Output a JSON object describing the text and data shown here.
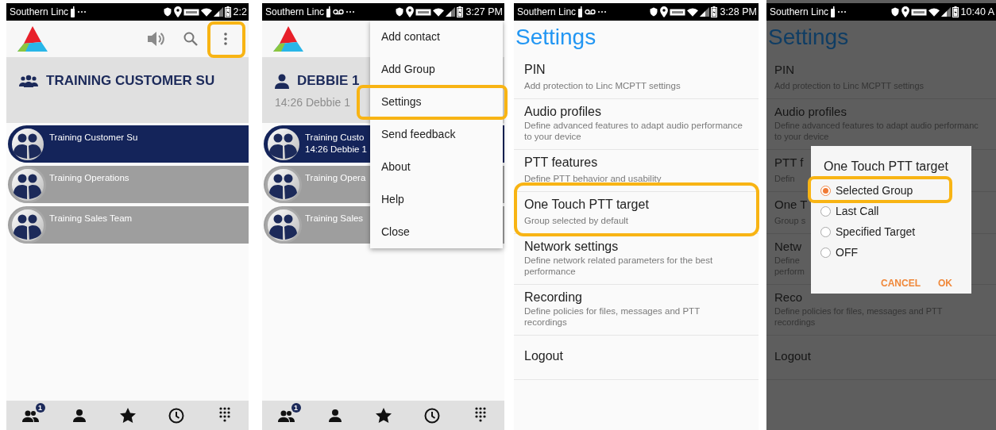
{
  "phones": [
    {
      "kind": "groups",
      "status_bar": {
        "carrier": "Southern Linc",
        "voicemail": false,
        "time": "2:2"
      },
      "actions": [
        {
          "kind": "speaker",
          "highlighted": false
        },
        {
          "kind": "search",
          "highlighted": false
        },
        {
          "kind": "more",
          "highlighted": true
        }
      ],
      "header": {
        "kind": "group",
        "title": "TRAINING CUSTOMER SU"
      },
      "rows": [
        {
          "name": "Training Customer Su",
          "selected": true
        },
        {
          "name": "Training Operations",
          "selected": false
        },
        {
          "name": "Training Sales Team",
          "selected": false
        }
      ],
      "bottom_nav": [
        {
          "kind": "groups",
          "badge": "1"
        },
        {
          "kind": "contacts"
        },
        {
          "kind": "favorites"
        },
        {
          "kind": "history"
        },
        {
          "kind": "dialpad"
        }
      ]
    },
    {
      "kind": "groups",
      "status_bar": {
        "carrier": "Southern Linc",
        "voicemail": true,
        "time": "3:27 PM"
      },
      "header": {
        "kind": "person",
        "title": "DEBBIE 1",
        "subtitle": "14:26 Debbie 1"
      },
      "rows": [
        {
          "name": "Training Custo",
          "subtitle": "14:26 Debbie 1",
          "selected": true
        },
        {
          "name": "Training Opera",
          "selected": false
        },
        {
          "name": "Training Sales",
          "selected": false
        }
      ],
      "menu": [
        {
          "label": "Add contact",
          "highlighted": false
        },
        {
          "label": "Add Group",
          "highlighted": false
        },
        {
          "label": "Settings",
          "highlighted": true
        },
        {
          "label": "Send feedback",
          "highlighted": false
        },
        {
          "label": "About",
          "highlighted": false
        },
        {
          "label": "Help",
          "highlighted": false
        },
        {
          "label": "Close",
          "highlighted": false
        }
      ],
      "bottom_nav": [
        {
          "kind": "groups",
          "badge": "1"
        },
        {
          "kind": "contacts"
        },
        {
          "kind": "favorites"
        },
        {
          "kind": "history"
        },
        {
          "kind": "dialpad"
        }
      ]
    },
    {
      "kind": "settings",
      "status_bar": {
        "carrier": "Southern Linc",
        "voicemail": true,
        "time": "3:28 PM"
      },
      "title": "Settings",
      "items": [
        {
          "title": "PIN",
          "subtitle": "Add protection to Linc MCPTT settings",
          "highlighted": false
        },
        {
          "title": "Audio profiles",
          "subtitle": "Define advanced features to adapt audio performance\nto your device",
          "highlighted": false
        },
        {
          "title": "PTT features",
          "subtitle": "Define PTT behavior and usability",
          "highlighted": false
        },
        {
          "title": "One Touch PTT target",
          "subtitle": "Group selected by default",
          "highlighted": true
        },
        {
          "title": "Network settings",
          "subtitle": "Define network related parameters for the best\nperformance",
          "highlighted": false
        },
        {
          "title": "Recording",
          "subtitle": "Define policies for files, messages and PTT\nrecordings",
          "highlighted": false
        },
        {
          "title": "Logout",
          "highlighted": false
        }
      ]
    },
    {
      "kind": "settings",
      "status_bar": {
        "carrier": "Southern Linc",
        "voicemail": false,
        "time": "10:40 A"
      },
      "title": "Settings",
      "items": [
        {
          "title": "PIN",
          "subtitle": "Add protection to Linc MCPTT settings",
          "highlighted": false
        },
        {
          "title": "Audio profiles",
          "subtitle": "Define advanced features to adapt audio performanc\nto your device",
          "highlighted": false
        },
        {
          "title": "PTT f",
          "subtitle": "Defin",
          "highlighted": false
        },
        {
          "title": "One T",
          "subtitle": "Group s",
          "highlighted": false
        },
        {
          "title": "Netw",
          "subtitle": "Define\nperform",
          "highlighted": false
        },
        {
          "title": "Reco",
          "subtitle": "Define policies for files, messages and PTT\nrecordings",
          "highlighted": false
        },
        {
          "title": "Logout",
          "highlighted": false
        }
      ],
      "dialog": {
        "title": "One Touch PTT target",
        "options": [
          {
            "label": "Selected Group",
            "selected": true,
            "highlighted": true
          },
          {
            "label": "Last Call",
            "selected": false,
            "highlighted": false
          },
          {
            "label": "Specified Target",
            "selected": false,
            "highlighted": false
          },
          {
            "label": "OFF",
            "selected": false,
            "highlighted": false
          }
        ],
        "buttons": [
          "CANCEL",
          "OK"
        ]
      }
    }
  ]
}
